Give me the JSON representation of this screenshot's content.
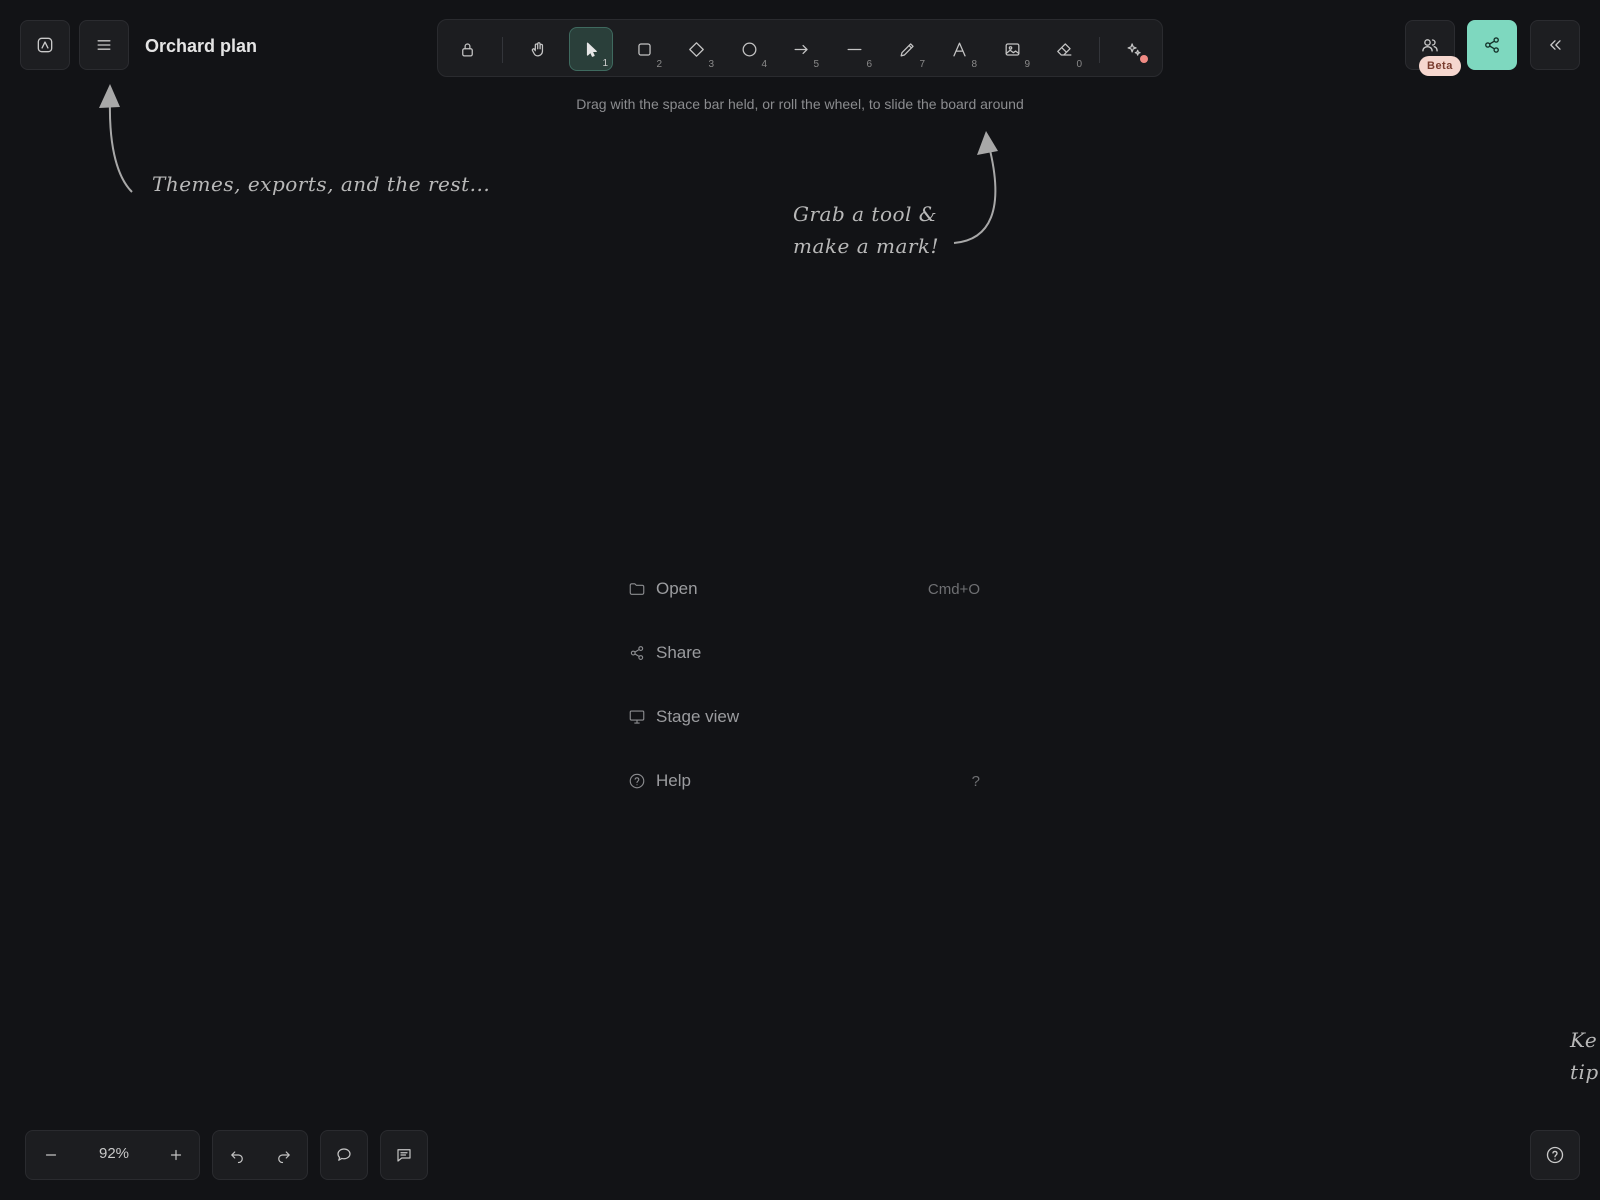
{
  "document": {
    "title": "Orchard plan"
  },
  "toolbar": {
    "tools": [
      {
        "name": "lock",
        "key": ""
      },
      {
        "name": "hand",
        "key": ""
      },
      {
        "name": "selection",
        "key": "1"
      },
      {
        "name": "rectangle",
        "key": "2"
      },
      {
        "name": "diamond",
        "key": "3"
      },
      {
        "name": "ellipse",
        "key": "4"
      },
      {
        "name": "arrow",
        "key": "5"
      },
      {
        "name": "line",
        "key": "6"
      },
      {
        "name": "draw",
        "key": "7"
      },
      {
        "name": "text",
        "key": "8"
      },
      {
        "name": "image",
        "key": "9"
      },
      {
        "name": "eraser",
        "key": "0"
      },
      {
        "name": "ai-tools",
        "key": ""
      }
    ],
    "active_tool": "selection",
    "hint": "Drag with the space bar held, or roll the wheel, to slide the board around"
  },
  "topright": {
    "beta_label": "Beta"
  },
  "annotations": {
    "menu_tip": "Themes, exports, and the rest...",
    "tool_tip_line1": "Grab a tool &",
    "tool_tip_line2": "make a mark!",
    "help_tip_line1": "Ke",
    "help_tip_line2": "tip"
  },
  "welcome_menu": {
    "items": [
      {
        "label": "Open",
        "shortcut": "Cmd+O",
        "icon": "folder-icon"
      },
      {
        "label": "Share",
        "shortcut": "",
        "icon": "share-icon"
      },
      {
        "label": "Stage view",
        "shortcut": "",
        "icon": "monitor-icon"
      },
      {
        "label": "Help",
        "shortcut": "?",
        "icon": "help-circle-icon"
      }
    ]
  },
  "footer": {
    "zoom": "92%"
  },
  "colors": {
    "background": "#121316",
    "accent": "#7ed8bf",
    "beta_badge": "#f6d7cf",
    "ai_dot": "#f08b84"
  }
}
